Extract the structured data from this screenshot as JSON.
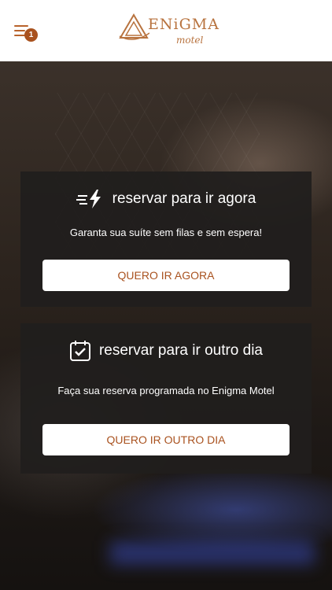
{
  "header": {
    "notification_count": "1",
    "logo_text": "ENiGMA",
    "logo_subtext": "motel"
  },
  "cards": [
    {
      "icon": "lightning-speed-icon",
      "title": "reservar para ir agora",
      "description": "Garanta sua suíte sem filas e sem espera!",
      "button_label": "QUERO IR AGORA"
    },
    {
      "icon": "calendar-check-icon",
      "title": "reservar para ir outro dia",
      "description": "Faça sua reserva programada no Enigma Motel",
      "button_label": "QUERO IR OUTRO DIA"
    }
  ],
  "colors": {
    "accent": "#a9521f",
    "card_bg": "#201e1d",
    "header_bg": "#ffffff"
  }
}
